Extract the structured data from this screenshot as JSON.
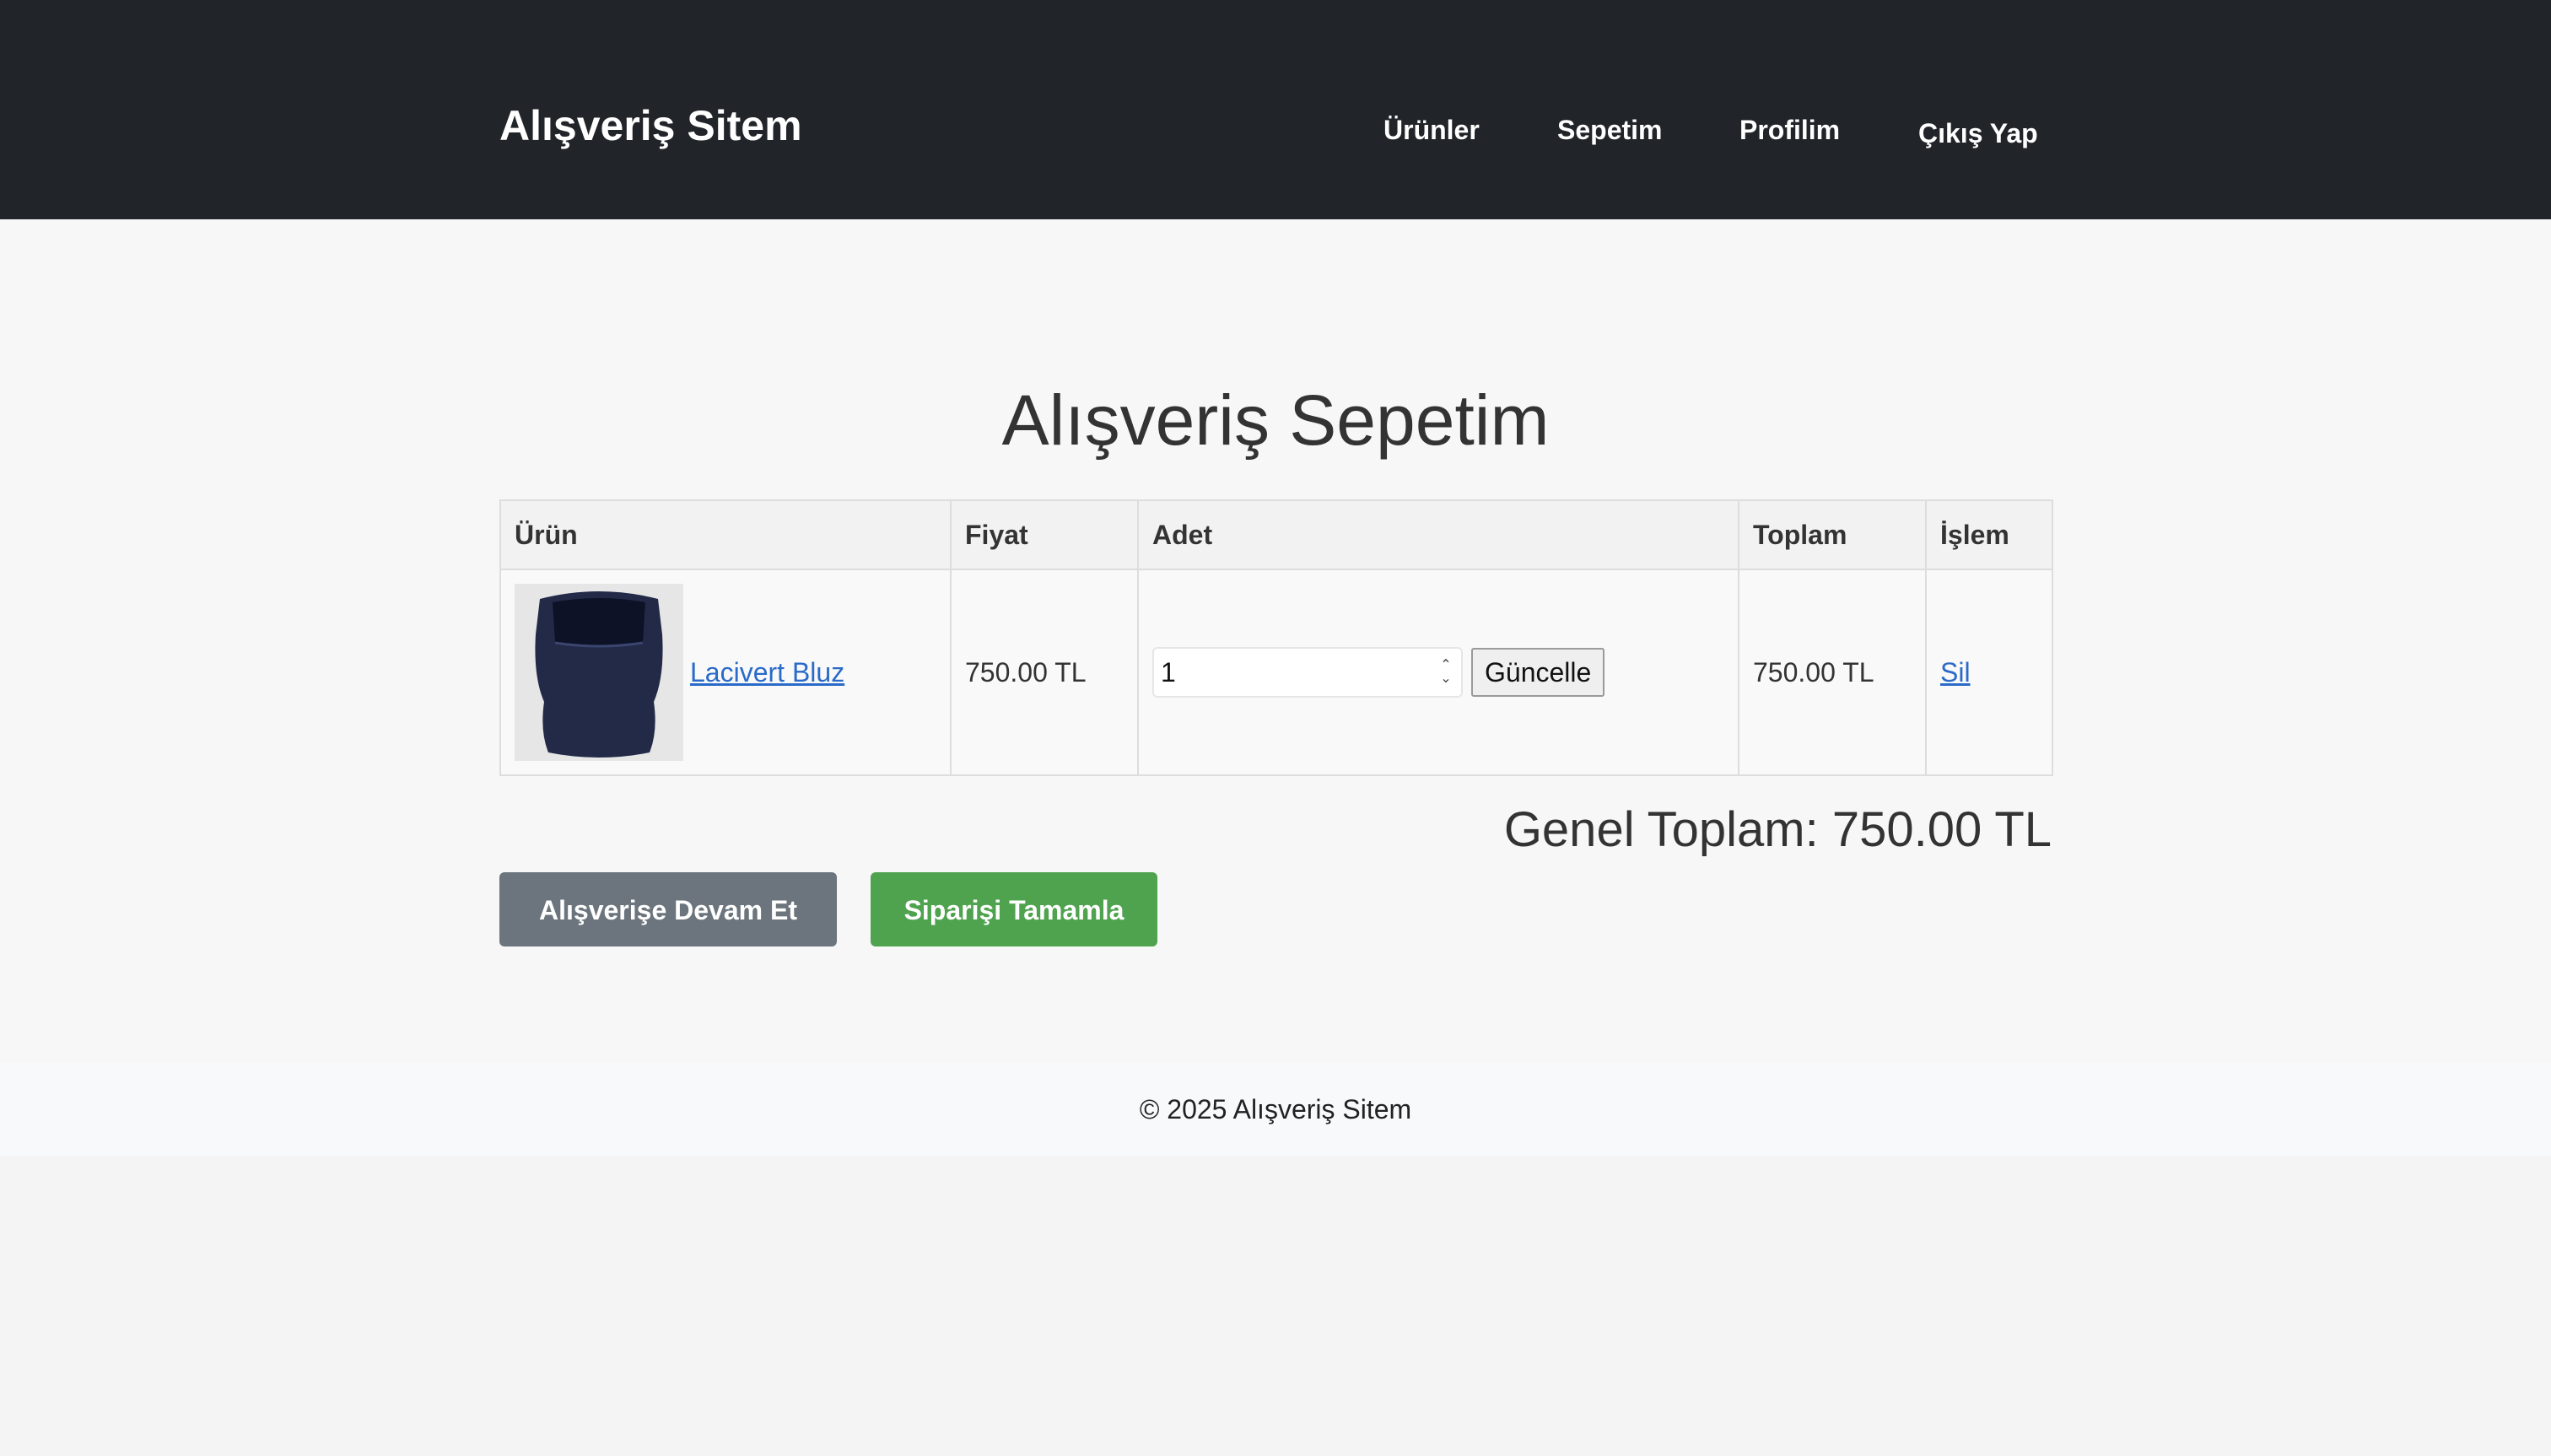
{
  "header": {
    "brand": "Alışveriş Sitem",
    "nav": [
      {
        "label": "Ürünler"
      },
      {
        "label": "Sepetim"
      },
      {
        "label": "Profilim"
      },
      {
        "label": "Çıkış Yap"
      }
    ]
  },
  "main": {
    "title": "Alışveriş Sepetim",
    "table": {
      "headers": [
        "Ürün",
        "Fiyat",
        "Adet",
        "Toplam",
        "İşlem"
      ],
      "rows": [
        {
          "product_name": "Lacivert Bluz",
          "image_icon": "navy-blouse-image",
          "price": "750.00 TL",
          "quantity": "1",
          "update_label": "Güncelle",
          "total": "750.00 TL",
          "action_label": "Sil"
        }
      ]
    },
    "grand_total": "Genel Toplam: 750.00 TL",
    "continue_label": "Alışverişe Devam Et",
    "checkout_label": "Siparişi Tamamla"
  },
  "footer": {
    "text": "© 2025 Alışveriş Sitem"
  },
  "colors": {
    "header_bg": "#212428",
    "link": "#2a6ac8",
    "continue_btn": "#6c757d",
    "checkout_btn": "#4fa34f"
  }
}
